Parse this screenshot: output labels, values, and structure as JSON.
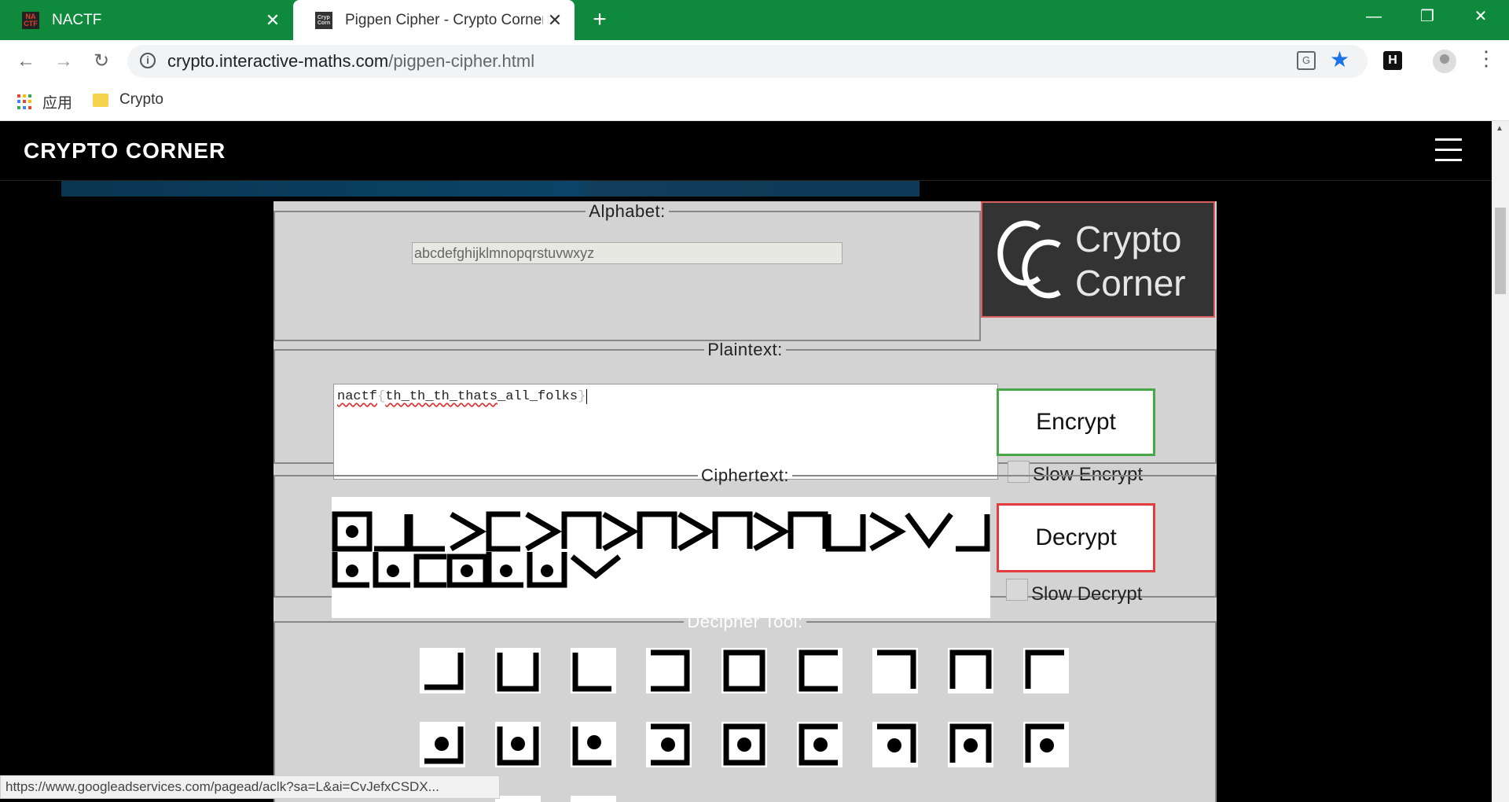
{
  "browser": {
    "tabs": [
      {
        "title": "NACTF",
        "favicon": "NACTF",
        "active": false
      },
      {
        "title": "Pigpen Cipher - Crypto Corner",
        "favicon": "Crypto Corner",
        "active": true
      }
    ],
    "url_host": "crypto.interactive-maths.com",
    "url_path": "/pigpen-cipher.html",
    "bookmarks": [
      {
        "label": "应用",
        "icon": "apps-icon"
      },
      {
        "label": "Crypto",
        "icon": "folder-icon"
      }
    ],
    "status_url": "https://www.googleadservices.com/pagead/aclk?sa=L&ai=CvJefxCSDX..."
  },
  "site": {
    "brand": "CRYPTO CORNER",
    "logo_line1": "Crypto",
    "logo_line2": "Corner"
  },
  "tool": {
    "alphabet_legend": "Alphabet:",
    "alphabet_value": "abcdefghijklmnopqrstuvwxyz",
    "plaintext_legend": "Plaintext:",
    "plaintext_value": "nactf{th_th_th_thats_all_folks}",
    "plaintext_parts": {
      "p1": "nactf",
      "p2": "{",
      "p3": "th_th_th_thats",
      "p4": "_all_folks",
      "p5": "}"
    },
    "encrypt_label": "Encrypt",
    "slow_encrypt_label": "Slow Encrypt",
    "ciphertext_legend": "Ciphertext:",
    "decrypt_label": "Decrypt",
    "slow_decrypt_label": "Slow Decrypt",
    "decipher_legend": "Decipher Tool:"
  },
  "colors": {
    "header_bg": "#0f8a3c",
    "encrypt_border": "#48a848",
    "decrypt_border": "#e43c3c"
  }
}
